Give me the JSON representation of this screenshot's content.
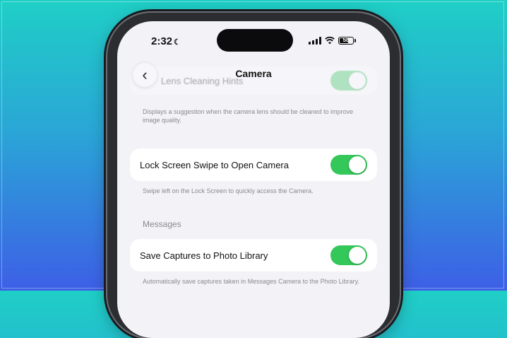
{
  "status_bar": {
    "time": "2:32",
    "focus_icon": "moon-icon",
    "battery_level": "58"
  },
  "nav": {
    "title": "Camera",
    "back_icon": "chevron-left-icon"
  },
  "rows": [
    {
      "label": "Lens Cleaning Hints",
      "toggle_on": true
    },
    {
      "label": "Lock Screen Swipe to Open Camera",
      "toggle_on": true
    },
    {
      "label": "Save Captures to Photo Library",
      "toggle_on": true
    }
  ],
  "footers": [
    "Displays a suggestion when the camera lens should be cleaned to improve image quality.",
    "Swipe left on the Lock Screen to quickly access the Camera.",
    "Automatically save captures taken in Messages Camera to the Photo Library."
  ],
  "section_messages": "Messages",
  "colors": {
    "accent_green": "#34c759",
    "background_top": "#1fcfc6",
    "background_bottom": "#3d5fe6"
  }
}
